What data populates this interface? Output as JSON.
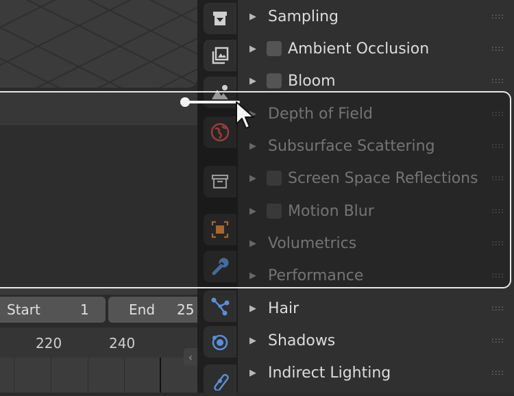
{
  "panels": [
    {
      "label": "Sampling",
      "checkbox": false
    },
    {
      "label": "Ambient Occlusion",
      "checkbox": true
    },
    {
      "label": "Bloom",
      "checkbox": true
    },
    {
      "label": "Depth of Field",
      "checkbox": false
    },
    {
      "label": "Subsurface Scattering",
      "checkbox": false
    },
    {
      "label": "Screen Space Reflections",
      "checkbox": true
    },
    {
      "label": "Motion Blur",
      "checkbox": true
    },
    {
      "label": "Volumetrics",
      "checkbox": false
    },
    {
      "label": "Performance",
      "checkbox": false
    },
    {
      "label": "Hair",
      "checkbox": false
    },
    {
      "label": "Shadows",
      "checkbox": false
    },
    {
      "label": "Indirect Lighting",
      "checkbox": false
    }
  ],
  "timeline": {
    "start_label": "Start",
    "start_value": "1",
    "end_label": "End",
    "end_value": "25",
    "ruler": [
      "220",
      "240"
    ]
  },
  "tabs": [
    {
      "icon": "render-icon",
      "color": "#cfcfcf"
    },
    {
      "icon": "output-icon",
      "color": "#cfcfcf"
    },
    {
      "icon": "view-layer-icon",
      "color": "#cfcfcf"
    },
    {
      "icon": "world-icon",
      "color": "#d05050"
    },
    {
      "icon": "collection-icon",
      "color": "#cfcfcf"
    },
    {
      "icon": "object-icon",
      "color": "#e08a3a"
    },
    {
      "icon": "modifier-icon",
      "color": "#5a8fd6"
    },
    {
      "icon": "particles-icon",
      "color": "#5a8fd6"
    },
    {
      "icon": "physics-icon",
      "color": "#5a8fd6"
    },
    {
      "icon": "constraints-icon",
      "color": "#5a8fd6"
    }
  ]
}
